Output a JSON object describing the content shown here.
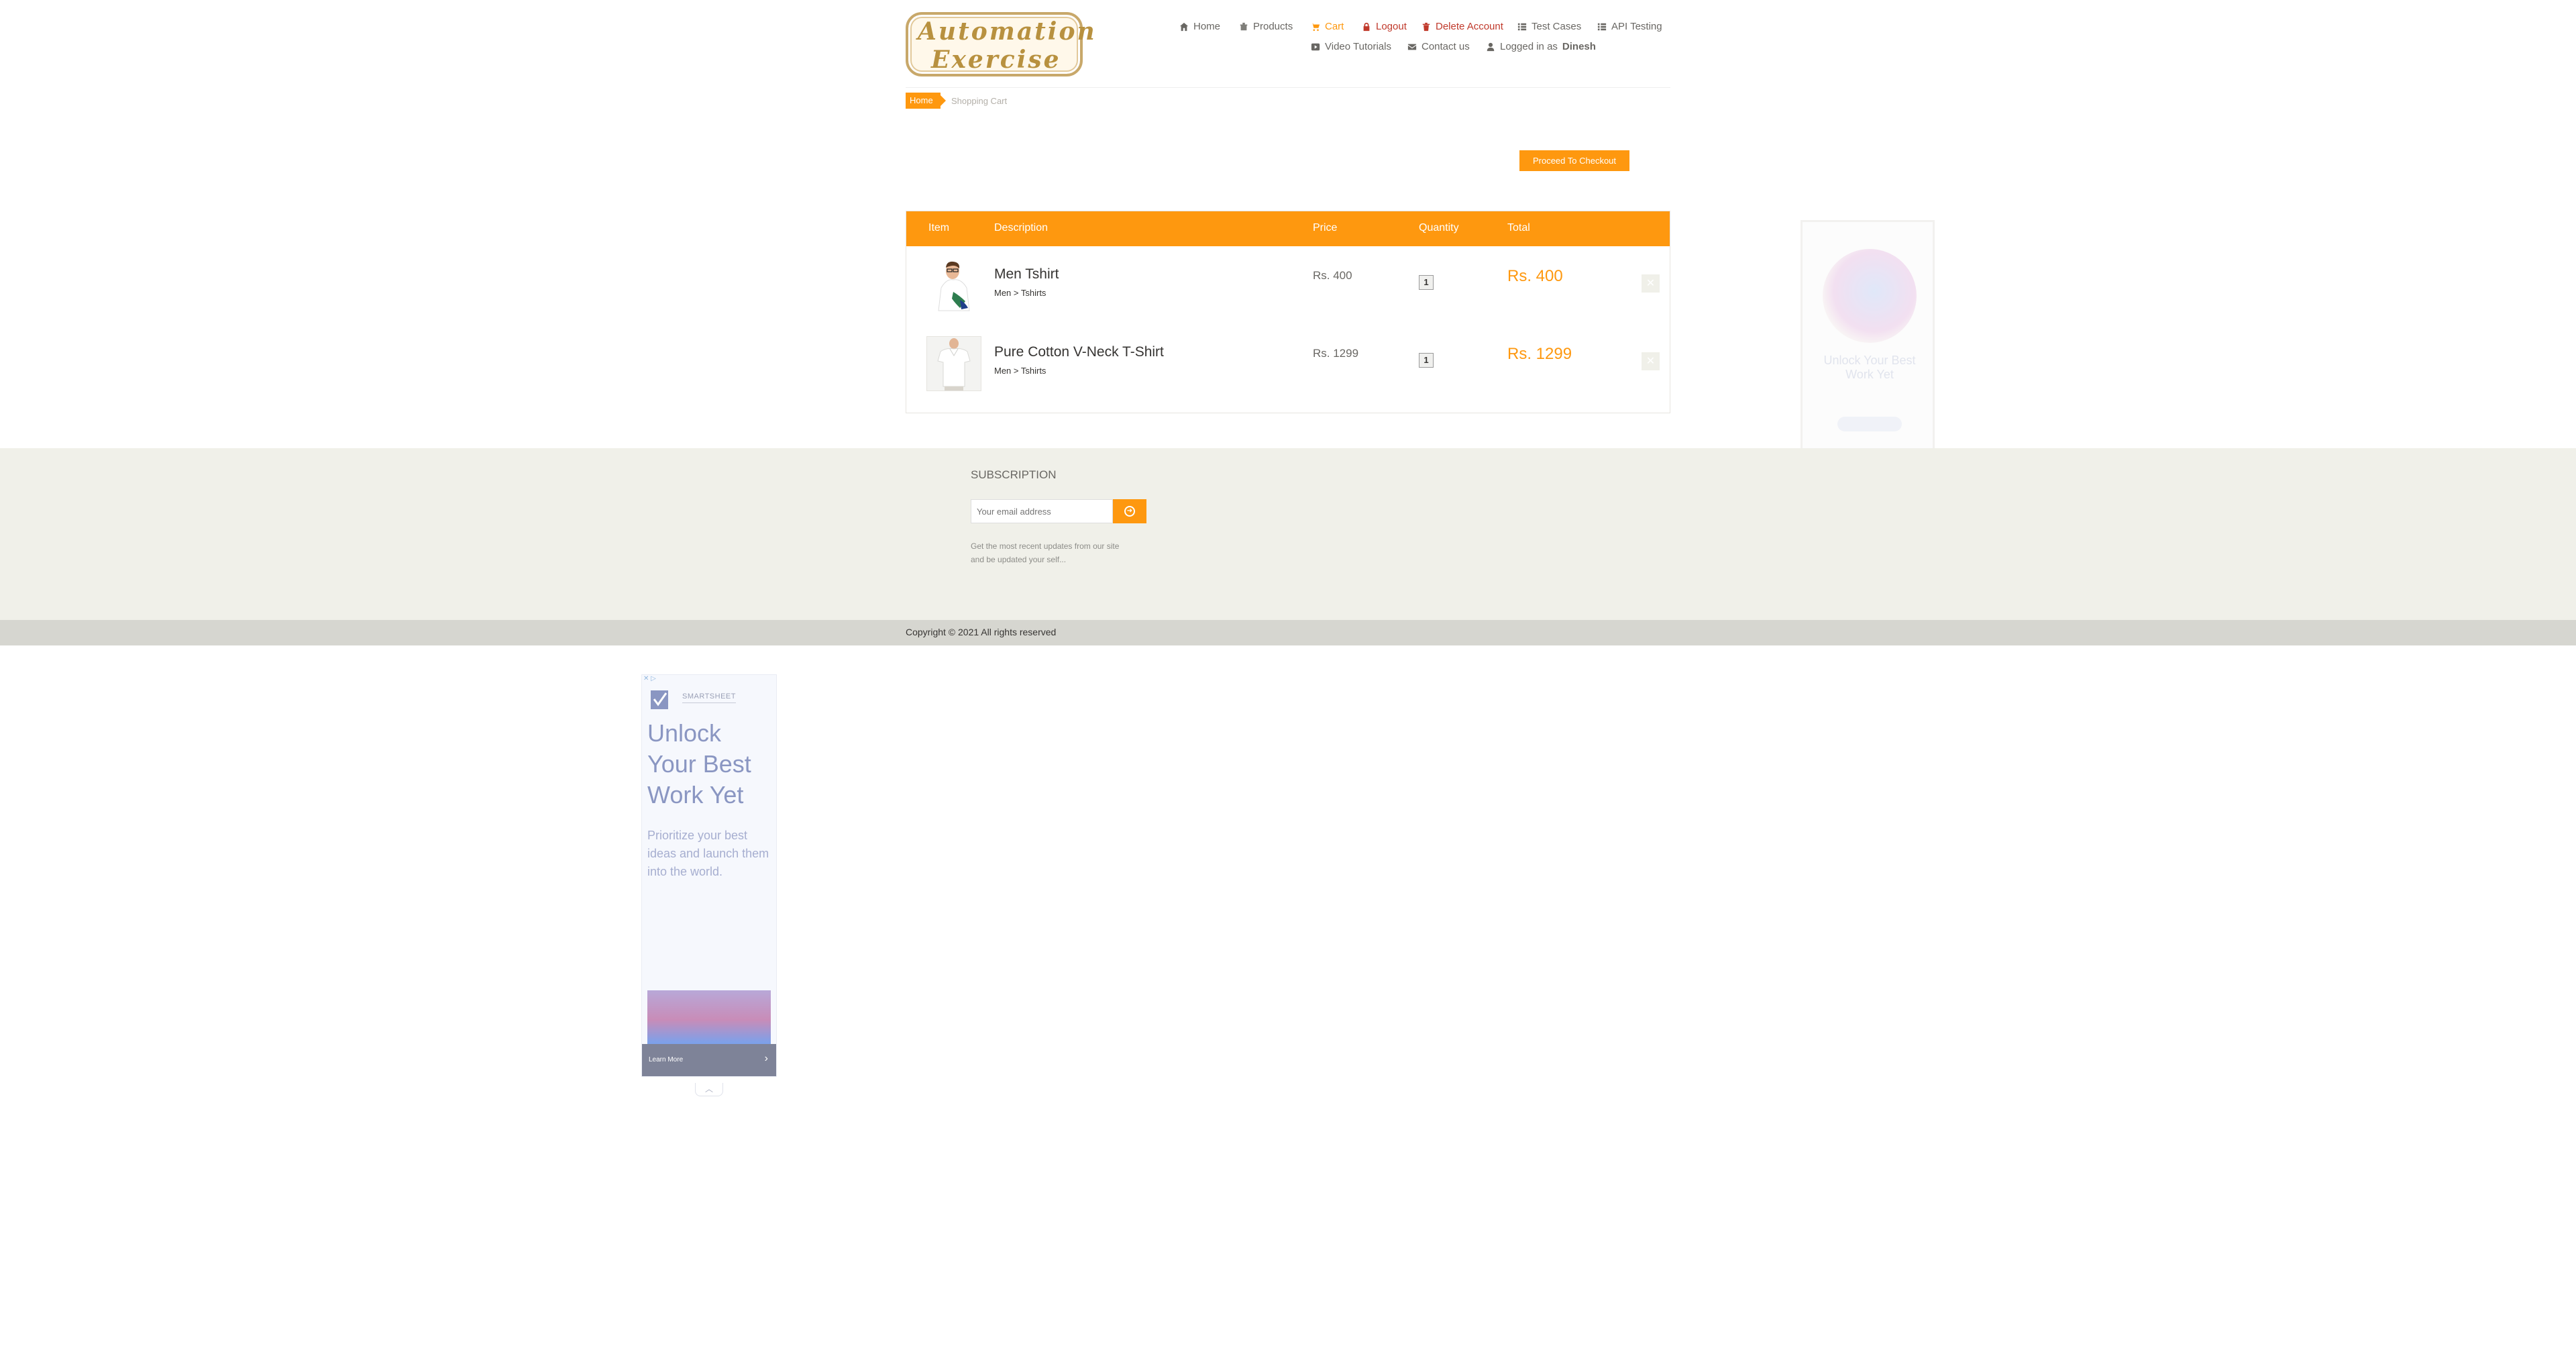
{
  "header": {
    "logo_line1": "Automation",
    "logo_line2": "Exercise",
    "nav": {
      "home": "Home",
      "products": "Products",
      "cart": "Cart",
      "logout": "Logout",
      "delete_account": "Delete Account",
      "test_cases": "Test Cases",
      "api_testing": "API Testing",
      "video_tutorials": "Video Tutorials",
      "contact_us": "Contact us",
      "logged_in_as": "Logged in as",
      "username": "Dinesh"
    }
  },
  "breadcrumb": {
    "home": "Home",
    "current": "Shopping Cart"
  },
  "checkout_button": "Proceed To Checkout",
  "cart": {
    "headers": {
      "item": "Item",
      "description": "Description",
      "price": "Price",
      "quantity": "Quantity",
      "total": "Total"
    },
    "rows": [
      {
        "name": "Men Tshirt",
        "category": "Men > Tshirts",
        "price": "Rs. 400",
        "quantity": "1",
        "total": "Rs. 400"
      },
      {
        "name": "Pure Cotton V-Neck T-Shirt",
        "category": "Men > Tshirts",
        "price": "Rs. 1299",
        "quantity": "1",
        "total": "Rs. 1299"
      }
    ]
  },
  "footer": {
    "subscription_title": "SUBSCRIPTION",
    "email_placeholder": "Your email address",
    "subscription_description": "Get the most recent updates from our site and be updated your self...",
    "copyright": "Copyright © 2021 All rights reserved"
  },
  "side_ad": {
    "headline": "Unlock Your Best Work Yet"
  },
  "bottom_ad": {
    "brand": "SMARTSHEET",
    "headline": "Unlock Your Best Work Yet",
    "body": "Prioritize your best ideas and launch them into the world.",
    "cta": "Learn More"
  },
  "colors": {
    "accent": "#fe980f",
    "danger": "#c0392b",
    "footer_bg": "#f0f0e9",
    "footer_bottom_bg": "#d6d6d0"
  }
}
